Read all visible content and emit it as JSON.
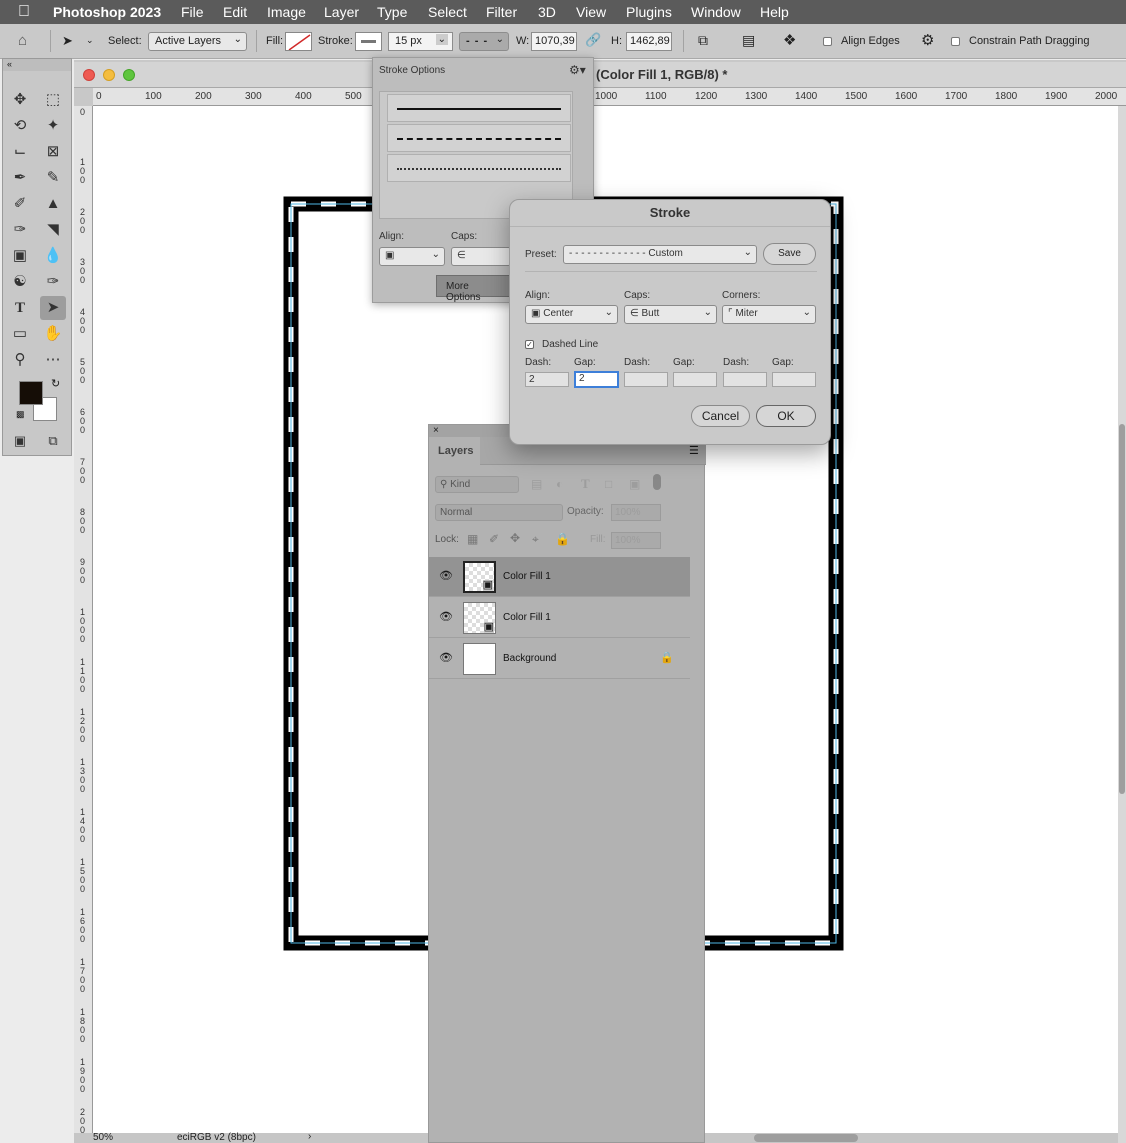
{
  "menubar": {
    "app_name": "Photoshop 2023",
    "menus": [
      "File",
      "Edit",
      "Image",
      "Layer",
      "Type",
      "Select",
      "Filter",
      "3D",
      "View",
      "Plugins",
      "Window",
      "Help"
    ]
  },
  "options_bar": {
    "select_label": "Select:",
    "select_value": "Active Layers",
    "fill_label": "Fill:",
    "stroke_label": "Stroke:",
    "stroke_width": "15 px",
    "width_label": "W:",
    "width_value": "1070,39",
    "height_label": "H:",
    "height_value": "1462,89",
    "align_edges": "Align Edges",
    "constrain": "Constrain Path Dragging"
  },
  "document": {
    "title": "(Color Fill 1, RGB/8) *",
    "ruler_top": [
      "0",
      "100",
      "200",
      "300",
      "400",
      "500",
      "1000",
      "1100",
      "1200",
      "1300",
      "1400",
      "1500",
      "1600",
      "1700",
      "1800",
      "1900",
      "2000"
    ],
    "ruler_left": [
      "0",
      "1\n0\n0",
      "2\n0\n0",
      "3\n0\n0",
      "4\n0\n0",
      "5\n0\n0",
      "6\n0\n0",
      "7\n0\n0",
      "8\n0\n0",
      "9\n0\n0",
      "1\n0\n0\n0",
      "1\n1\n0\n0",
      "1\n2\n0\n0",
      "1\n3\n0\n0",
      "1\n4\n0\n0",
      "1\n5\n0\n0",
      "1\n6\n0\n0",
      "1\n7\n0\n0",
      "1\n8\n0\n0",
      "1\n9\n0\n0",
      "2\n0\n0\n0"
    ],
    "zoom": "50%",
    "profile": "eciRGB v2 (8bpc)"
  },
  "stroke_options_popover": {
    "title": "Stroke Options",
    "align_label": "Align:",
    "caps_label": "Caps:",
    "more_options": "More Options"
  },
  "stroke_dialog": {
    "title": "Stroke",
    "preset_label": "Preset:",
    "preset_value": "- - - - - - - - - - - - - Custom",
    "save": "Save",
    "align_label": "Align:",
    "align_value": "Center",
    "caps_label": "Caps:",
    "caps_value": "Butt",
    "corners_label": "Corners:",
    "corners_value": "Miter",
    "dashed_line": "Dashed Line",
    "dash_label": "Dash:",
    "gap_label": "Gap:",
    "dash1": "2",
    "gap1": "2",
    "cancel": "Cancel",
    "ok": "OK"
  },
  "layers_panel": {
    "tab": "Layers",
    "kind": "Kind",
    "blend_mode": "Normal",
    "opacity_label": "Opacity:",
    "opacity_value": "100%",
    "lock_label": "Lock:",
    "fill_label": "Fill:",
    "fill_value": "100%",
    "layers": [
      {
        "name": "Color Fill 1",
        "selected": true
      },
      {
        "name": "Color Fill 1",
        "selected": false
      },
      {
        "name": "Background",
        "locked": true
      }
    ]
  }
}
